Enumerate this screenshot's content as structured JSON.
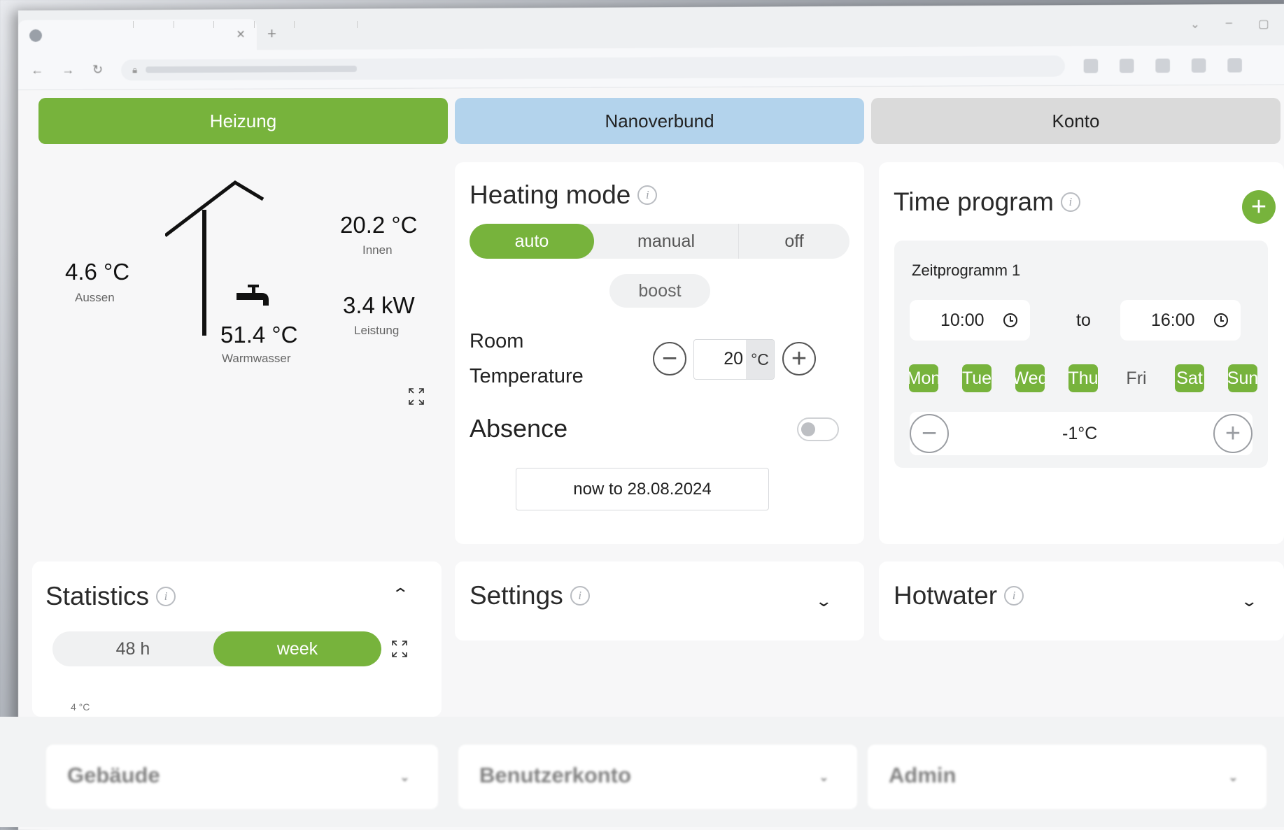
{
  "colors": {
    "accent": "#77b33c",
    "nanoverbund": "#b3d3ec",
    "konto": "#dadada"
  },
  "browser": {
    "tab_title": "",
    "url": ""
  },
  "nav": {
    "heizung": "Heizung",
    "nanoverbund": "Nanoverbund",
    "konto": "Konto"
  },
  "overview": {
    "outside_value": "4.6 °C",
    "outside_label": "Aussen",
    "inside_value": "20.2 °C",
    "inside_label": "Innen",
    "power_value": "3.4 kW",
    "power_label": "Leistung",
    "hotwater_value": "51.4 °C",
    "hotwater_label": "Warmwasser"
  },
  "heating_mode": {
    "title": "Heating mode",
    "modes": [
      "auto",
      "manual",
      "off"
    ],
    "selected": "auto",
    "boost": "boost",
    "room_label_1": "Room",
    "room_label_2": "Temperature",
    "room_value": "20",
    "room_unit": "°C",
    "absence_label": "Absence",
    "absence_enabled": false,
    "absence_range": "now to 28.08.2024"
  },
  "time_program": {
    "title": "Time program",
    "program_name": "Zeitprogramm 1",
    "from": "10:00",
    "to_label": "to",
    "to": "16:00",
    "days": [
      {
        "label": "Mon",
        "active": true
      },
      {
        "label": "Tue",
        "active": true
      },
      {
        "label": "Wed",
        "active": true
      },
      {
        "label": "Thu",
        "active": true
      },
      {
        "label": "Fri",
        "active": false
      },
      {
        "label": "Sat",
        "active": true
      },
      {
        "label": "Sun",
        "active": true
      }
    ],
    "offset": "-1°C"
  },
  "statistics": {
    "title": "Statistics",
    "ranges": [
      "48 h",
      "week"
    ],
    "selected": "week",
    "chart_axis_label": "4 °C"
  },
  "settings": {
    "title": "Settings"
  },
  "hotwater": {
    "title": "Hotwater"
  },
  "lower_sections": [
    "Gebäude",
    "Benutzerkonto",
    "Admin"
  ],
  "icons": {
    "info": "info-icon",
    "expand": "expand-icon",
    "tap": "faucet-icon",
    "add": "plus-icon",
    "clock": "clock-icon"
  }
}
